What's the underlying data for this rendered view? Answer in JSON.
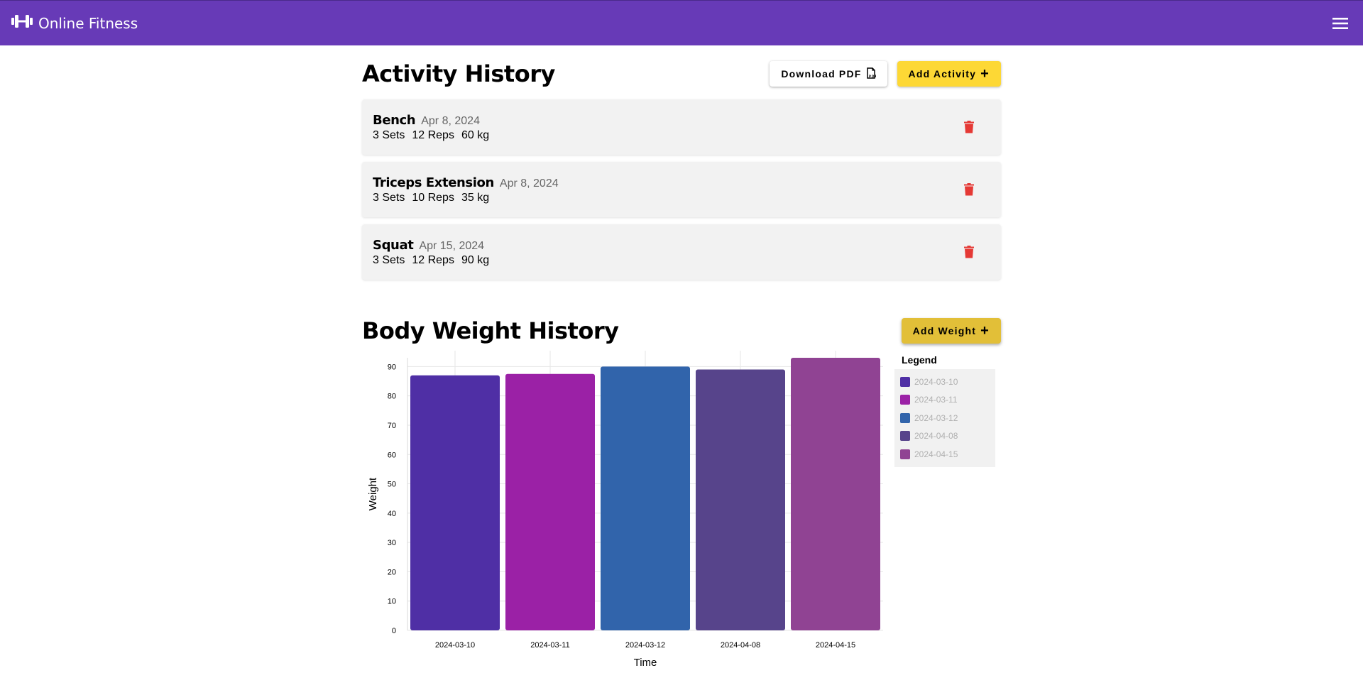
{
  "app": {
    "title": "Online Fitness",
    "logo_icon": "dumbbell-icon",
    "menu_icon": "hamburger-menu-icon"
  },
  "activity": {
    "title": "Activity History",
    "download_label": "Download PDF",
    "add_label": "Add Activity",
    "items": [
      {
        "name": "Bench",
        "date": "Apr 8, 2024",
        "sets": "3 Sets",
        "reps": "12 Reps",
        "weight": "60 kg"
      },
      {
        "name": "Triceps Extension",
        "date": "Apr 8, 2024",
        "sets": "3 Sets",
        "reps": "10 Reps",
        "weight": "35 kg"
      },
      {
        "name": "Squat",
        "date": "Apr 15, 2024",
        "sets": "3 Sets",
        "reps": "12 Reps",
        "weight": "90 kg"
      }
    ],
    "delete_icon": "trash-icon",
    "delete_color": "#e53935"
  },
  "weight": {
    "title": "Body Weight History",
    "add_label": "Add Weight"
  },
  "chart_data": {
    "type": "bar",
    "categories": [
      "2024-03-10",
      "2024-03-11",
      "2024-03-12",
      "2024-04-08",
      "2024-04-15"
    ],
    "values": [
      87,
      87.5,
      90,
      89,
      93
    ],
    "colors": [
      "#4f2fa5",
      "#9b21a6",
      "#3164ab",
      "#57448b",
      "#904393"
    ],
    "xlabel": "Time",
    "ylabel": "Weight",
    "ylim": [
      0,
      93
    ],
    "yticks": [
      0,
      10,
      20,
      30,
      40,
      50,
      60,
      70,
      80,
      90
    ],
    "grid": true,
    "legend": {
      "title": "Legend",
      "placement": "right"
    }
  }
}
